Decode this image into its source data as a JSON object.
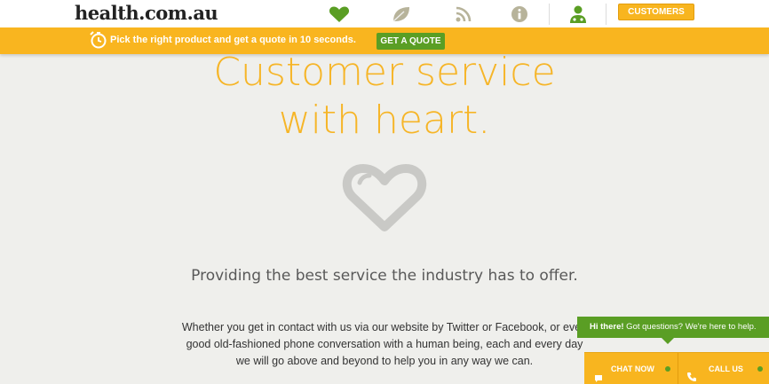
{
  "header": {
    "logo": "health.com.au",
    "nav_icons": [
      "heart-icon",
      "leaf-icon",
      "rss-icon",
      "info-icon",
      "doctor-icon"
    ],
    "customers_label": "CUSTOMERS"
  },
  "quote_bar": {
    "text": "Pick the right product and get a quote in 10 seconds.",
    "button_label": "GET A QUOTE"
  },
  "main": {
    "headline_line1": "Customer service",
    "headline_line2": "with heart.",
    "subtitle": "Providing the best service the industry has to offer.",
    "body_line1": "Whether you get in contact with us via our website by Twitter or Facebook, or even",
    "body_line2": "good old-fashioned phone conversation with a human being, each and every day",
    "body_line3": "we will go above and beyond to help you in any way we can."
  },
  "chat_widget": {
    "greeting_bold": "Hi there!",
    "greeting_text": " Got questions? We're here to help.",
    "chat_label": "CHAT NOW",
    "call_label": "CALL US"
  },
  "colors": {
    "accent_yellow": "#f8b51f",
    "accent_green": "#5a9e24",
    "background": "#efefec"
  }
}
